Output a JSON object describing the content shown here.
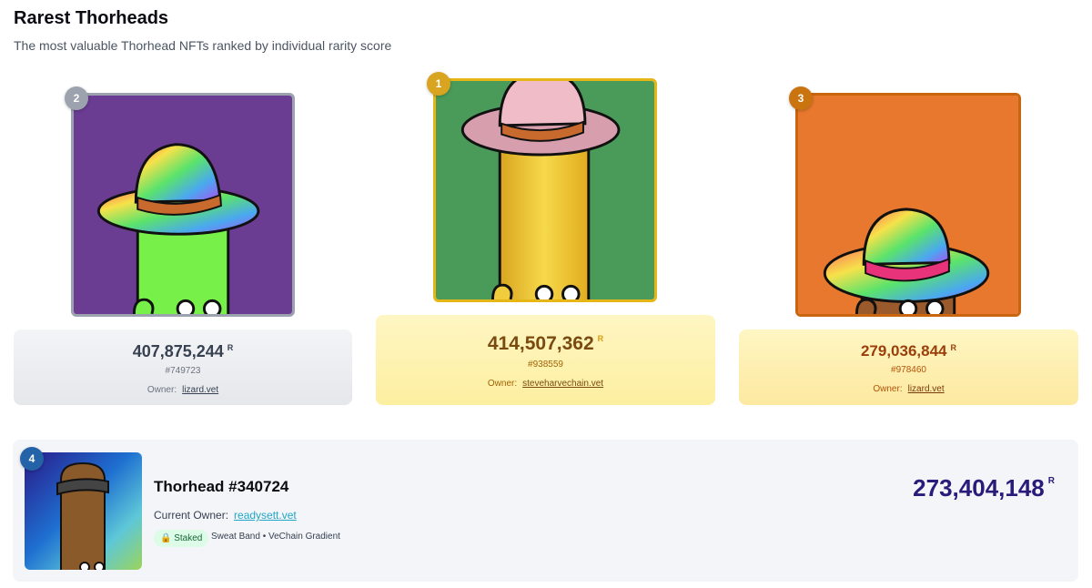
{
  "header": {
    "title": "Rarest Thorheads",
    "subtitle": "The most valuable Thorhead NFTs ranked by individual rarity score"
  },
  "currency_symbol": "R",
  "podium": [
    {
      "rank": "2",
      "score": "407,875,244",
      "token": "#749723",
      "owner_label": "Owner:",
      "owner": "lizard.vet",
      "colors": {
        "bg": "#6a3c92",
        "body": "#77f04a",
        "frame": "#9ca3af"
      }
    },
    {
      "rank": "1",
      "score": "414,507,362",
      "token": "#938559",
      "owner_label": "Owner:",
      "owner": "steveharvechain.vet",
      "colors": {
        "bg": "#4a9b5a",
        "body": "#f1cd3e",
        "frame": "#e6b516"
      }
    },
    {
      "rank": "3",
      "score": "279,036,844",
      "token": "#978460",
      "owner_label": "Owner:",
      "owner": "lizard.vet",
      "colors": {
        "bg": "#e7782e",
        "body": "#9b5a2b",
        "frame": "#c9650f"
      }
    }
  ],
  "list": [
    {
      "rank": "4",
      "title": "Thorhead #340724",
      "owner_label": "Current Owner:",
      "owner": "readysett.vet",
      "badge": "🔒 Staked",
      "traits": "Sweat Band • VeChain Gradient",
      "score": "273,404,148"
    }
  ]
}
